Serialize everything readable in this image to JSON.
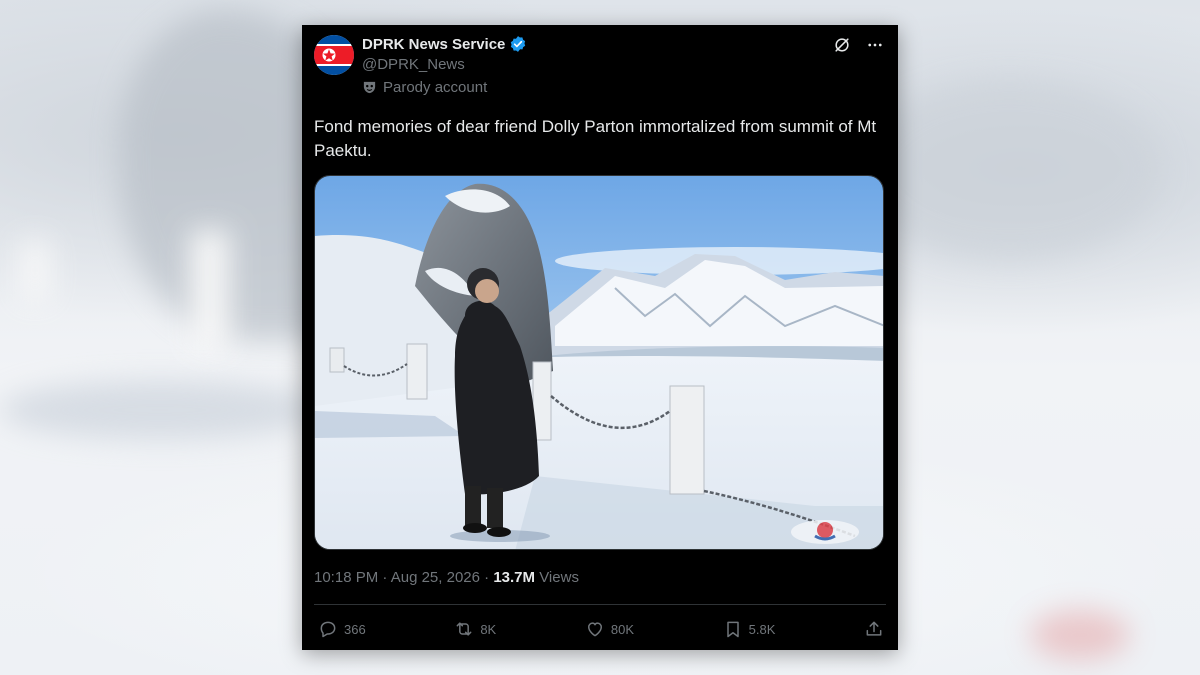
{
  "tweet": {
    "author_name": "DPRK News Service",
    "handle": "@DPRK_News",
    "parody_label": "Parody account",
    "text": "Fond memories of dear friend Dolly Parton immortalized from summit of Mt Paektu.",
    "time": "10:18 PM",
    "separator": "·",
    "date": "Aug 25, 2026",
    "views_count": "13.7M",
    "views_label": "Views"
  },
  "actions": {
    "replies": "366",
    "reposts": "8K",
    "likes": "80K",
    "bookmarks": "5.8K"
  },
  "icons": {
    "verified": "verified-badge-icon",
    "grok": "grok-icon",
    "more": "more-icon",
    "parody": "mask-icon",
    "reply": "reply-icon",
    "repost": "repost-icon",
    "like": "heart-icon",
    "bookmark": "bookmark-icon",
    "share": "share-icon"
  },
  "colors": {
    "card_bg": "#000000",
    "primary_text": "#e7e9ea",
    "secondary_text": "#71767b",
    "verified_blue": "#1d9bf0"
  }
}
